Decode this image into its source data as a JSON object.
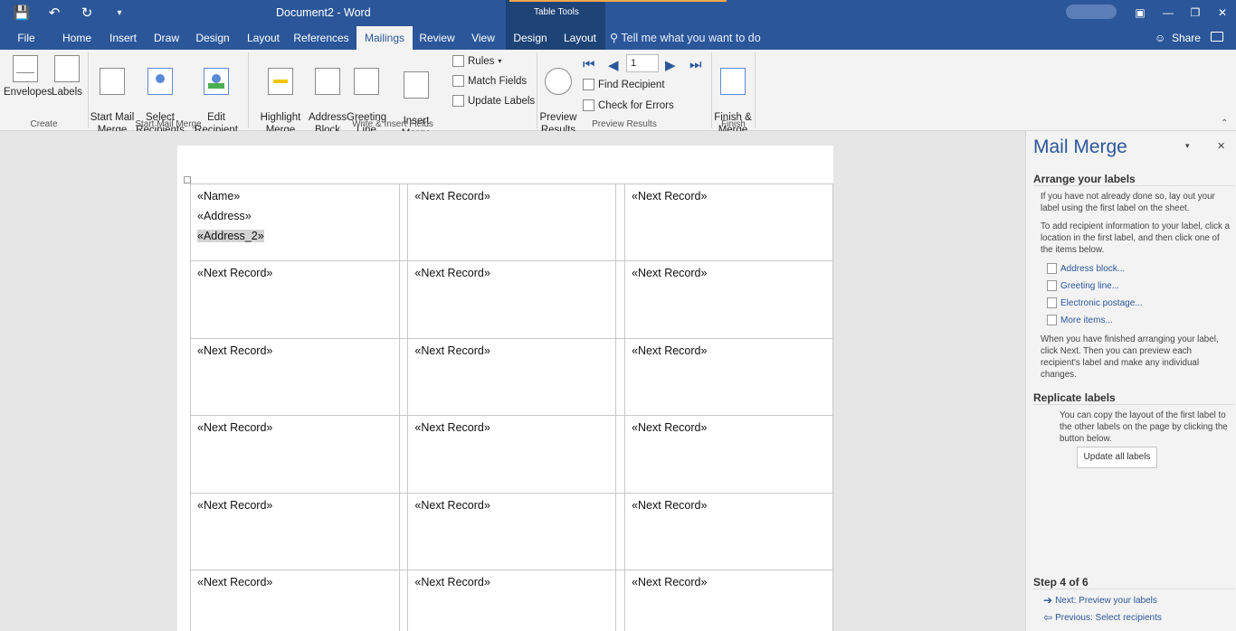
{
  "title_bar": {
    "doc_title": "Document2  -  Word",
    "context_title": "Table Tools"
  },
  "tabs": [
    {
      "label": "File"
    },
    {
      "label": "Home"
    },
    {
      "label": "Insert"
    },
    {
      "label": "Draw"
    },
    {
      "label": "Design"
    },
    {
      "label": "Layout"
    },
    {
      "label": "References"
    },
    {
      "label": "Mailings"
    },
    {
      "label": "Review"
    },
    {
      "label": "View"
    },
    {
      "label": "Design"
    },
    {
      "label": "Layout"
    }
  ],
  "tell_me": "Tell me what you want to do",
  "share": "Share",
  "ribbon": {
    "envelopes": "Envelopes",
    "labels": "Labels",
    "start_mail_merge": "Start Mail\nMerge",
    "select_recipients": "Select\nRecipients",
    "edit_recipient_list": "Edit\nRecipient List",
    "highlight_merge_fields": "Highlight\nMerge Fields",
    "address_block": "Address\nBlock",
    "greeting_line": "Greeting\nLine",
    "insert_merge_field": "Insert Merge\nField",
    "rules": "Rules",
    "match_fields": "Match Fields",
    "update_labels": "Update Labels",
    "preview_results": "Preview\nResults",
    "record_number": "1",
    "find_recipient": "Find Recipient",
    "check_for_errors": "Check for Errors",
    "finish_merge": "Finish &\nMerge",
    "groups": {
      "create": "Create",
      "start_mail_merge": "Start Mail Merge",
      "write_insert": "Write & Insert Fields",
      "preview_results": "Preview Results",
      "finish": "Finish"
    }
  },
  "document": {
    "first_cell": [
      "«Name»",
      "«Address»",
      "«Address_2»"
    ],
    "next_record": "«Next Record»"
  },
  "pane": {
    "title": "Mail Merge",
    "arrange_heading": "Arrange your labels",
    "arrange_p1": "If you have not already done so, lay out your label using the first label on the sheet.",
    "arrange_p2": "To add recipient information to your label, click a location in the first label, and then click one of the items below.",
    "links": [
      "Address block...",
      "Greeting line...",
      "Electronic postage...",
      "More items..."
    ],
    "arrange_p3": "When you have finished arranging your label, click Next. Then you can preview each recipient's label and make any individual changes.",
    "replicate_heading": "Replicate labels",
    "replicate_p": "You can copy the layout of the first label to the other labels on the page by clicking the button below.",
    "update_all_labels": "Update all labels",
    "step": "Step 4 of 6",
    "next": "Next: Preview your labels",
    "previous": "Previous: Select recipients"
  }
}
